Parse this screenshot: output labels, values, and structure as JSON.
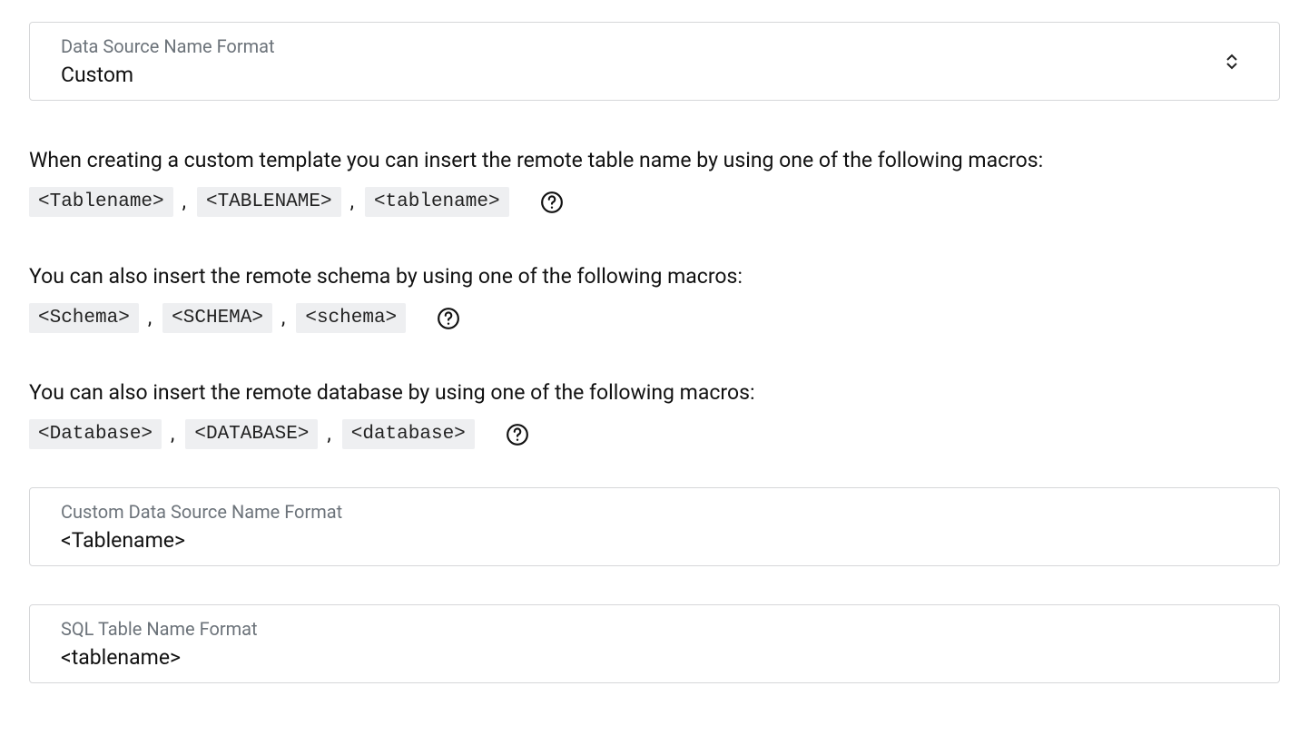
{
  "dataSourceNameFormat": {
    "label": "Data Source Name Format",
    "value": "Custom"
  },
  "tableSection": {
    "intro": "When creating a custom template you can insert the remote table name by using one of the following macros:",
    "macros": [
      "<Tablename>",
      "<TABLENAME>",
      "<tablename>"
    ]
  },
  "schemaSection": {
    "intro": "You can also insert the remote schema by using one of the following macros:",
    "macros": [
      "<Schema>",
      "<SCHEMA>",
      "<schema>"
    ]
  },
  "databaseSection": {
    "intro": "You can also insert the remote database by using one of the following macros:",
    "macros": [
      "<Database>",
      "<DATABASE>",
      "<database>"
    ]
  },
  "customDataSourceNameFormat": {
    "label": "Custom Data Source Name Format",
    "value": "<Tablename>"
  },
  "sqlTableNameFormat": {
    "label": "SQL Table Name Format",
    "value": "<tablename>"
  },
  "comma": ","
}
